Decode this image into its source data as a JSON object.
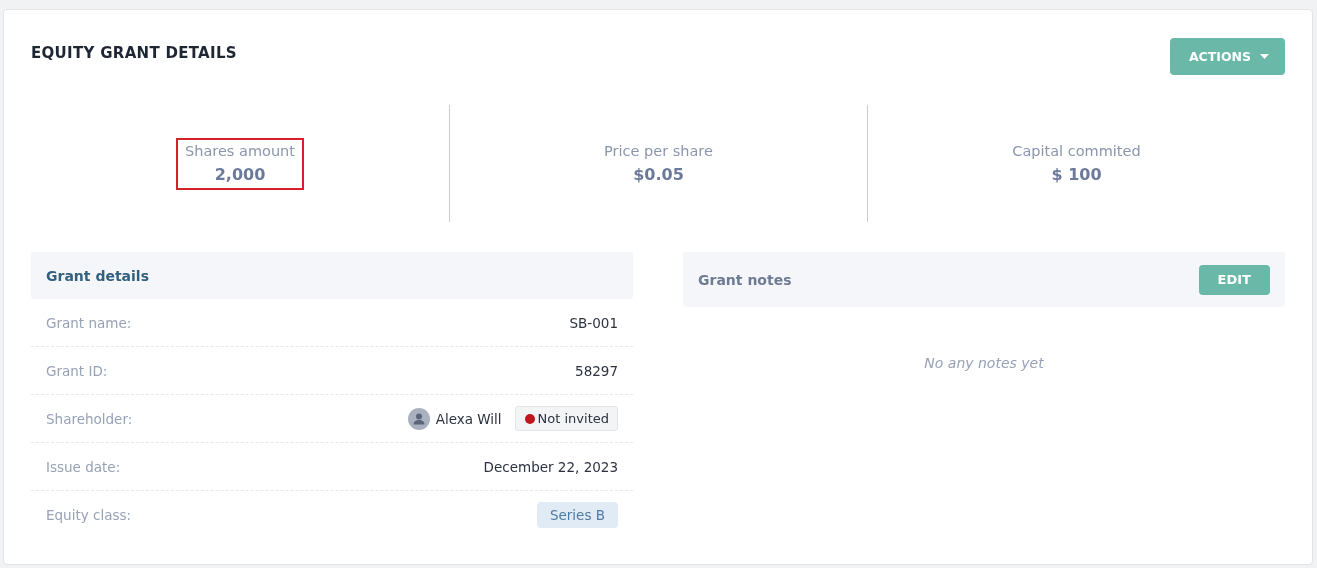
{
  "title": "EQUITY GRANT DETAILS",
  "actions_button": {
    "label": "ACTIONS"
  },
  "stats": [
    {
      "label": "Shares amount",
      "value": "2,000",
      "highlighted": true
    },
    {
      "label": "Price per share",
      "value": "$0.05",
      "highlighted": false
    },
    {
      "label": "Capital commited",
      "value": "$ 100",
      "highlighted": false
    }
  ],
  "grant_details": {
    "title": "Grant details",
    "rows": [
      {
        "kind": "text",
        "label": "Grant name:",
        "value": "SB-001"
      },
      {
        "kind": "text",
        "label": "Grant ID:",
        "value": "58297"
      },
      {
        "kind": "person",
        "label": "Shareholder:",
        "value": "Alexa Will",
        "status": {
          "label": "Not invited",
          "color": "#c0161e"
        }
      },
      {
        "kind": "text",
        "label": "Issue date:",
        "value": "December 22, 2023"
      },
      {
        "kind": "tag",
        "label": "Equity class:",
        "value": "Series B"
      }
    ]
  },
  "grant_notes": {
    "title": "Grant notes",
    "edit_button": {
      "label": "EDIT"
    },
    "empty_text": "No any notes yet"
  }
}
